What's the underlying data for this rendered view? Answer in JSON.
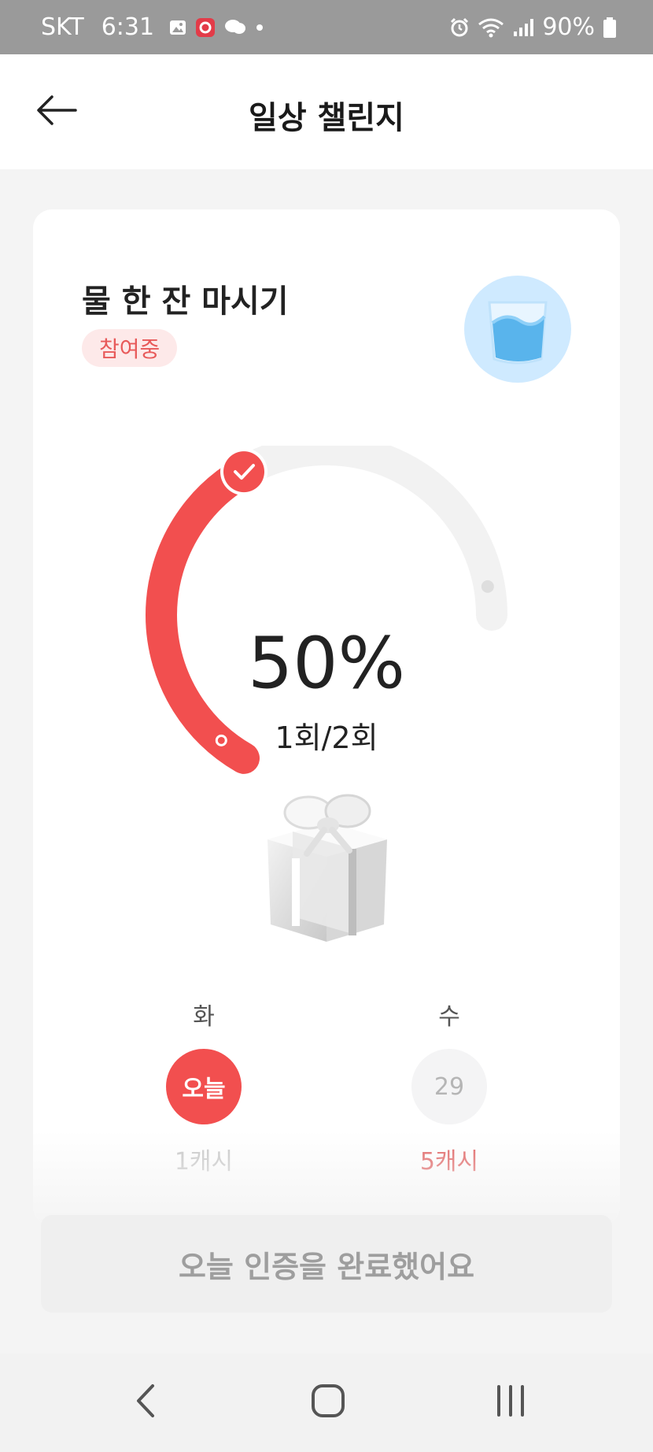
{
  "status_bar": {
    "carrier": "SKT",
    "time": "6:31",
    "battery": "90%",
    "icons_left": [
      "image-icon",
      "notification-app-icon",
      "chat-bubble-icon",
      "dot-icon"
    ],
    "icons_right": [
      "alarm-icon",
      "wifi-icon",
      "signal-icon",
      "battery-icon"
    ]
  },
  "header": {
    "title": "일상 챌린지",
    "back_icon": "arrow-left-icon"
  },
  "challenge": {
    "title": "물 한 잔 마시기",
    "status": "참여중",
    "icon": "water-glass-icon"
  },
  "progress": {
    "percent_label": "50%",
    "fraction": 0.5,
    "count_label": "1회/2회",
    "accent_color": "#f24f4f",
    "track_color": "#f2f2f2"
  },
  "gift_icon": "gift-box-icon",
  "days": [
    {
      "weekday": "화",
      "circle": "오늘",
      "reward": "1캐시",
      "state": "today"
    },
    {
      "weekday": "수",
      "circle": "29",
      "reward": "5캐시",
      "state": "future"
    }
  ],
  "complete_button": {
    "label": "오늘 인증을 완료했어요"
  },
  "nav": {
    "back": "nav-back-icon",
    "home": "nav-home-icon",
    "recents": "nav-recents-icon"
  }
}
